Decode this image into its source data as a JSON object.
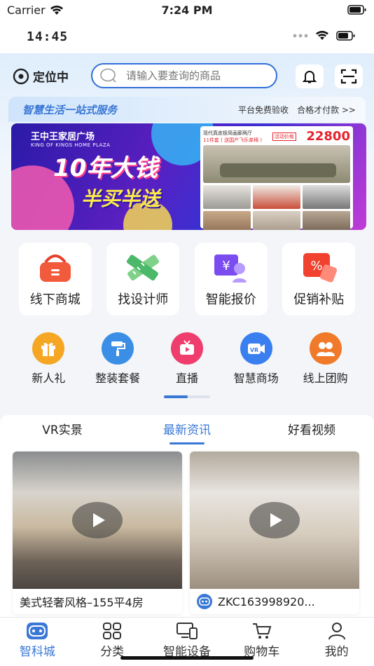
{
  "system_status": {
    "carrier": "Carrier",
    "time": "7:24 PM"
  },
  "app_status": {
    "time": "14:45"
  },
  "header": {
    "location_label": "定位中",
    "search_placeholder": "请输入要查询的商品",
    "slogan": "智慧生活一站式服务",
    "promises": [
      "平台免费验收",
      "合格才付款 >>"
    ]
  },
  "banner": {
    "brand": "王中王家居广场",
    "brand_en": "KING OF KINGS HOME PLAZA",
    "headline": "10年大钱",
    "subline": "半买半送",
    "panel_title": "现代真皮极简画廊两厅",
    "panel_sub": "11件套 ( 送国产飞乐单椅 )",
    "panel_tag": "活动价格",
    "price": "22800"
  },
  "features": [
    {
      "label": "线下商城",
      "icon": "shopping-basket-icon"
    },
    {
      "label": "找设计师",
      "icon": "ruler-pencil-icon"
    },
    {
      "label": "智能报价",
      "icon": "price-tag-icon"
    },
    {
      "label": "促销补贴",
      "icon": "discount-icon"
    }
  ],
  "shortcuts": [
    {
      "label": "新人礼",
      "icon": "gift-icon",
      "color": "#f5a623"
    },
    {
      "label": "整装套餐",
      "icon": "paint-roller-icon",
      "color": "#3a8ee6"
    },
    {
      "label": "直播",
      "icon": "tv-icon",
      "color": "#ef3e6e"
    },
    {
      "label": "智慧商场",
      "icon": "vr-camera-icon",
      "color": "#3a7ff0"
    },
    {
      "label": "线上团购",
      "icon": "group-icon",
      "color": "#f07a2a"
    }
  ],
  "tabs": [
    "VR实景",
    "最新资讯",
    "好看视频"
  ],
  "active_tab": "最新资讯",
  "feed": [
    {
      "caption": "美式轻奢风格–155平4房"
    },
    {
      "caption": "ZKC163998920..."
    }
  ],
  "nav": [
    "智科城",
    "分类",
    "智能设备",
    "购物车",
    "我的"
  ],
  "colors": {
    "accent": "#3a78d6",
    "price_red": "#e5232d"
  }
}
